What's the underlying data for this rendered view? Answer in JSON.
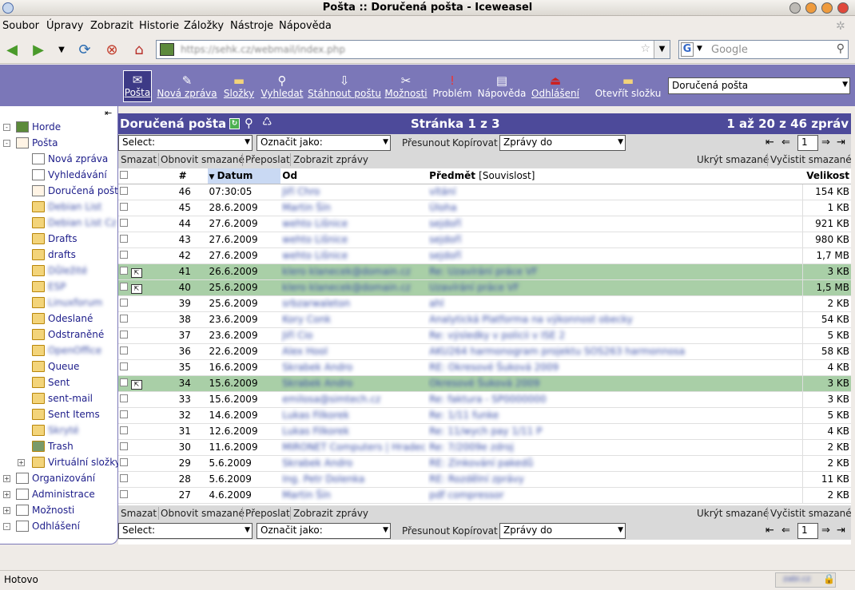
{
  "window": {
    "title": "Pošta :: Doručená pošta - Iceweasel"
  },
  "menu": [
    "Soubor",
    "Úpravy",
    "Zobrazit",
    "Historie",
    "Záložky",
    "Nástroje",
    "Nápověda"
  ],
  "nav": {
    "url": "https://sehk.cz/webmail/index.php",
    "search_placeholder": "Google"
  },
  "toolbar": {
    "items": [
      "Pošta",
      "Nová zpráva",
      "Složky",
      "Vyhledat",
      "Stáhnout poštu",
      "Možnosti",
      "Problém",
      "Nápověda",
      "Odhlášení",
      "Otevřít složku"
    ],
    "folder_select": "Doručená pošta"
  },
  "sidebar": {
    "items": [
      "Horde",
      "Pošta",
      "Nová zpráva",
      "Vyhledávání",
      "Doručená pošta",
      "Debian List",
      "Debian List Cz",
      "Drafts",
      "drafts",
      "Důležité",
      "ESP",
      "Linuxforum",
      "Odeslané",
      "Odstraněné",
      "OpenOffice",
      "Queue",
      "Sent",
      "sent-mail",
      "Sent Items",
      "Skryté",
      "Trash",
      "Virtuální složky",
      "Organizování",
      "Administrace",
      "Možnosti",
      "Odhlášení"
    ]
  },
  "mailbox": {
    "title": "Doručená pošta",
    "page_info": "Stránka 1 z 3",
    "count_info": "1 až 20 z 46 zpráv"
  },
  "actions": {
    "select": "Select:",
    "mark_as": "Označit jako:",
    "move": "Přesunout",
    "copy": "Kopírovat",
    "messages_to": "Zprávy do",
    "page_number": "1",
    "purge": "Smazat",
    "undelete": "Obnovit smazané",
    "forward": "Přeposlat",
    "view": "Zobrazit zprávy",
    "hide_deleted": "Ukrýt smazané",
    "purge_deleted": "Vyčistit smazané"
  },
  "columns": {
    "num": "#",
    "date": "Datum",
    "from": "Od",
    "subject": "Předmět",
    "thread": "[Souvislost]",
    "size": "Velikost"
  },
  "messages": [
    {
      "num": "46",
      "date": "07:30:05",
      "from": "Jiří Chro",
      "subject": "vítání",
      "size": "154 KB",
      "flag": false
    },
    {
      "num": "45",
      "date": "28.6.2009",
      "from": "Martin Šín",
      "subject": "Úloha",
      "size": "1 KB",
      "flag": false
    },
    {
      "num": "44",
      "date": "27.6.2009",
      "from": "wehto Lišnice",
      "subject": "sejdoří",
      "size": "921 KB",
      "flag": false
    },
    {
      "num": "43",
      "date": "27.6.2009",
      "from": "wehto Lišnice",
      "subject": "sejdoří",
      "size": "980 KB",
      "flag": false
    },
    {
      "num": "42",
      "date": "27.6.2009",
      "from": "wehto Lišnice",
      "subject": "sejdoří",
      "size": "1,7 MB",
      "flag": false
    },
    {
      "num": "41",
      "date": "26.6.2009",
      "from": "klero klanecek@domain.cz",
      "subject": "Re: Uzavírání práce VF",
      "size": "3 KB",
      "flag": true
    },
    {
      "num": "40",
      "date": "25.6.2009",
      "from": "klero klanecek@domain.cz",
      "subject": "Uzavírání práce VF",
      "size": "1,5 MB",
      "flag": true
    },
    {
      "num": "39",
      "date": "25.6.2009",
      "from": "srbzarwaleton",
      "subject": "ahl",
      "size": "2 KB",
      "flag": false
    },
    {
      "num": "38",
      "date": "23.6.2009",
      "from": "Kory Conk",
      "subject": "Analytická Platforma na výkonnost obecky",
      "size": "54 KB",
      "flag": false
    },
    {
      "num": "37",
      "date": "23.6.2009",
      "from": "Jiří Cio",
      "subject": "Re: výsledky v policii v ISE 2",
      "size": "5 KB",
      "flag": false
    },
    {
      "num": "36",
      "date": "22.6.2009",
      "from": "Alex Hool",
      "subject": "AKU264 harmonogram projektu SOS263 harmonnosa",
      "size": "58 KB",
      "flag": false
    },
    {
      "num": "35",
      "date": "16.6.2009",
      "from": "Skrabek Andro",
      "subject": "RE: Okresové Šuková 2009",
      "size": "4 KB",
      "flag": false
    },
    {
      "num": "34",
      "date": "15.6.2009",
      "from": "Skrabek Andro",
      "subject": "Okresové Šuková 2009",
      "size": "3 KB",
      "flag": true
    },
    {
      "num": "33",
      "date": "15.6.2009",
      "from": "emilosa@simtech.cz",
      "subject": "Re: faktura - SP0000000",
      "size": "3 KB",
      "flag": false
    },
    {
      "num": "32",
      "date": "14.6.2009",
      "from": "Lukas Filkorek",
      "subject": "Re: 1/11 funke",
      "size": "5 KB",
      "flag": false
    },
    {
      "num": "31",
      "date": "12.6.2009",
      "from": "Lukas Filkorek",
      "subject": "Re: 11/wych pay 1/11 P",
      "size": "4 KB",
      "flag": false
    },
    {
      "num": "30",
      "date": "11.6.2009",
      "from": "MIRONET Computers | Hradec",
      "subject": "Re: 7/2009e zdroj",
      "size": "2 KB",
      "flag": false
    },
    {
      "num": "29",
      "date": "5.6.2009",
      "from": "Skrabek Andro",
      "subject": "RE: Zinkování pakedů",
      "size": "2 KB",
      "flag": false
    },
    {
      "num": "28",
      "date": "5.6.2009",
      "from": "Ing. Petr Dolenka",
      "subject": "RE: Rozdělní zprávy",
      "size": "11 KB",
      "flag": false
    },
    {
      "num": "27",
      "date": "4.6.2009",
      "from": "Martin Šín",
      "subject": "pdf compressor",
      "size": "2 KB",
      "flag": false
    }
  ],
  "status": {
    "text": "Hotovo",
    "right": "zabi.cz"
  }
}
